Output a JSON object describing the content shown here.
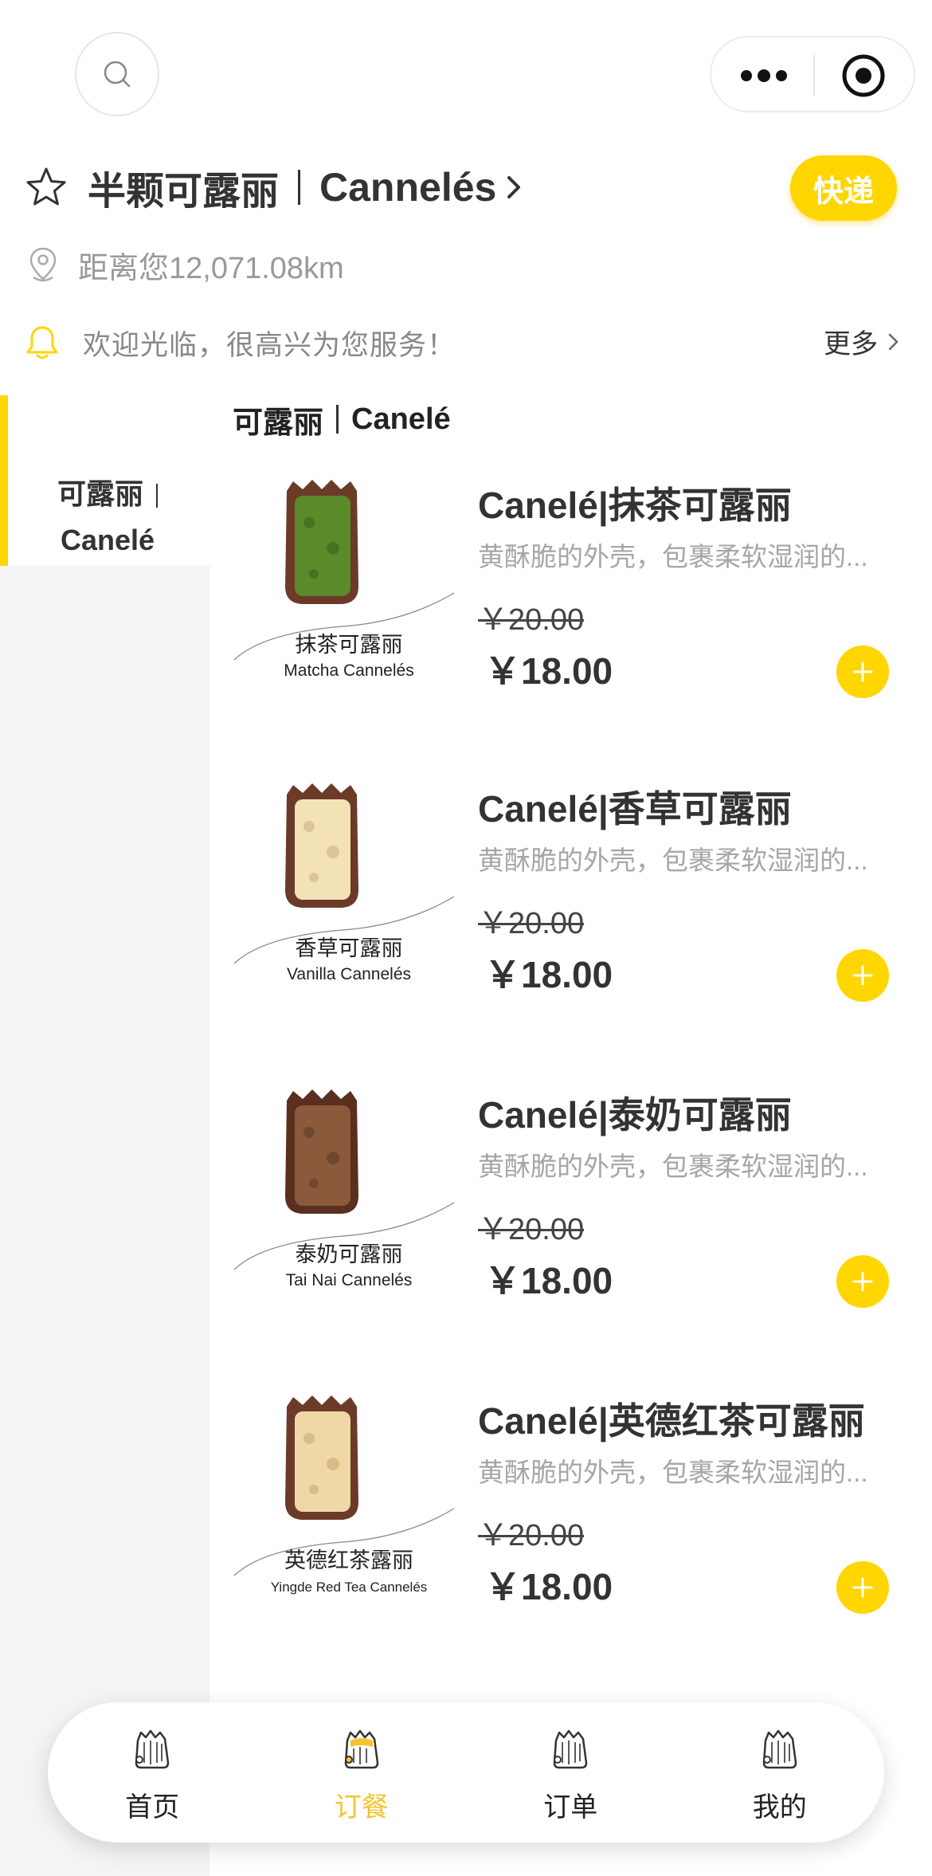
{
  "shop": {
    "name": "半颗可露丽",
    "name_en": "Cannelés",
    "express_label": "快递",
    "distance": "距离您12,071.08km"
  },
  "notice": {
    "text": "欢迎光临，很高兴为您服务！",
    "more_label": "更多"
  },
  "sidebar": {
    "items": [
      {
        "line1": "可露丽",
        "line2": "Canelé"
      }
    ]
  },
  "category": {
    "name_cn": "可露丽",
    "name_en": "Canelé"
  },
  "products": [
    {
      "title": "Canelé|抹茶可露丽",
      "description": "黄酥脆的外壳，包裹柔软湿润的...",
      "old_price": "￥20.00",
      "price": "￥18.00",
      "caption_cn": "抹茶可露丽",
      "caption_en": "Matcha Cannelés",
      "crumb_color": "#5a8a2a"
    },
    {
      "title": "Canelé|香草可露丽",
      "description": "黄酥脆的外壳，包裹柔软湿润的...",
      "old_price": "￥20.00",
      "price": "￥18.00",
      "caption_cn": "香草可露丽",
      "caption_en": "Vanilla Cannelés",
      "crumb_color": "#f3e2b6"
    },
    {
      "title": "Canelé|泰奶可露丽",
      "description": "黄酥脆的外壳，包裹柔软湿润的...",
      "old_price": "￥20.00",
      "price": "￥18.00",
      "caption_cn": "泰奶可露丽",
      "caption_en": "Tai Nai  Cannelés",
      "crumb_color": "#8a5a3a"
    },
    {
      "title": "Canelé|英德红茶可露丽",
      "description": "黄酥脆的外壳，包裹柔软湿润的...",
      "old_price": "￥20.00",
      "price": "￥18.00",
      "caption_cn": "英德红茶露丽",
      "caption_en": "Yingde Red Tea Cannelés",
      "crumb_color": "#f0d7a6"
    }
  ],
  "tabbar": {
    "items": [
      {
        "label": "首页",
        "icon": "canele-home-icon",
        "active": false
      },
      {
        "label": "订餐",
        "icon": "canele-order-icon",
        "active": true
      },
      {
        "label": "订单",
        "icon": "canele-orders-icon",
        "active": false
      },
      {
        "label": "我的",
        "icon": "canele-profile-icon",
        "active": false
      }
    ]
  },
  "colors": {
    "accent": "#ffd600",
    "active_tab": "#f4c430",
    "muted_text": "#999999"
  }
}
